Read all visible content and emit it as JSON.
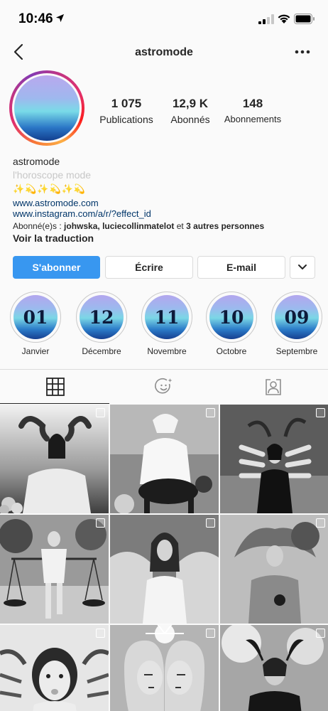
{
  "status_bar": {
    "time": "10:46",
    "icons": [
      "location-arrow-icon",
      "cellular-signal-icon",
      "wifi-icon",
      "battery-icon"
    ]
  },
  "header": {
    "title": "astromode",
    "back_icon": "chevron-left-icon",
    "more_icon": "ellipsis-icon"
  },
  "profile": {
    "stats": [
      {
        "value": "1 075",
        "label": "Publications"
      },
      {
        "value": "12,9 K",
        "label": "Abonnés"
      },
      {
        "value": "148",
        "label": "Abonnements"
      }
    ],
    "name": "astromode",
    "category": "l'horoscope mode",
    "emoji_line": "✨💫✨💫✨💫",
    "links": [
      "www.astromode.com",
      "www.instagram.com/a/r/?effect_id"
    ],
    "followed_by": {
      "prefix": "Abonné(e)s : ",
      "names": "johwska, luciecollinmatelot",
      "connector": " et ",
      "others": "3 autres personnes"
    },
    "translate": "Voir la traduction"
  },
  "actions": {
    "follow": "S'abonner",
    "message": "Écrire",
    "email": "E-mail",
    "more_icon": "chevron-down-icon"
  },
  "highlights": [
    {
      "number": "01",
      "label": "Janvier"
    },
    {
      "number": "12",
      "label": "Décembre"
    },
    {
      "number": "11",
      "label": "Novembre"
    },
    {
      "number": "10",
      "label": "Octobre"
    },
    {
      "number": "09",
      "label": "Septembre"
    }
  ],
  "tabs": {
    "active": "grid",
    "icons": [
      "grid-icon",
      "face-filter-icon",
      "tagged-user-icon"
    ]
  },
  "posts": {
    "count_visible": 9,
    "subjects": [
      "aries",
      "sagittarius",
      "cancer",
      "libra",
      "virgo",
      "leo",
      "cancer-crab",
      "gemini",
      "capricorn"
    ]
  },
  "colors": {
    "accent": "#3897f0",
    "text": "#262626",
    "link": "#003569",
    "muted": "#c7c7c7",
    "border": "#dbdbdb"
  }
}
